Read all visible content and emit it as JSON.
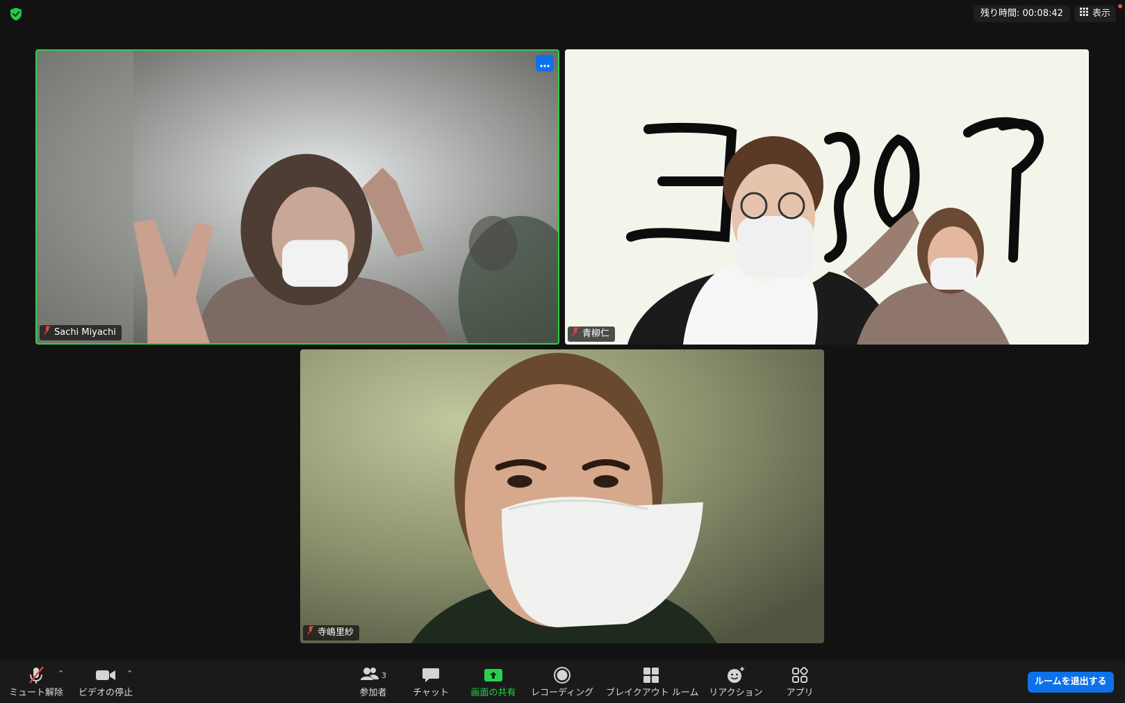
{
  "topbar": {
    "timer_text": "残り時間: 00:08:42",
    "view_label": "表示"
  },
  "participants": [
    {
      "name": "Sachi Miyachi",
      "muted": true,
      "active_speaker": true
    },
    {
      "name": "青柳仁",
      "muted": true,
      "active_speaker": false
    },
    {
      "name": "寺嶋里紗",
      "muted": true,
      "active_speaker": false
    }
  ],
  "toolbar": {
    "unmute_label": "ミュート解除",
    "stop_video_label": "ビデオの停止",
    "participants_label": "参加者",
    "participants_count": "3",
    "chat_label": "チャット",
    "share_label": "画面の共有",
    "record_label": "レコーディング",
    "breakout_label": "ブレイクアウト ルーム",
    "reactions_label": "リアクション",
    "apps_label": "アプリ",
    "leave_label": "ルームを退出する"
  },
  "colors": {
    "accent_blue": "#0e71eb",
    "active_green": "#2fce4a",
    "share_green": "#28d24b",
    "background": "#121212"
  },
  "icons": [
    "shield-check-icon",
    "grid-icon",
    "more-icon",
    "mic-muted-icon",
    "video-icon",
    "participants-icon",
    "chat-icon",
    "share-screen-icon",
    "record-icon",
    "breakout-icon",
    "reaction-icon",
    "apps-icon"
  ]
}
